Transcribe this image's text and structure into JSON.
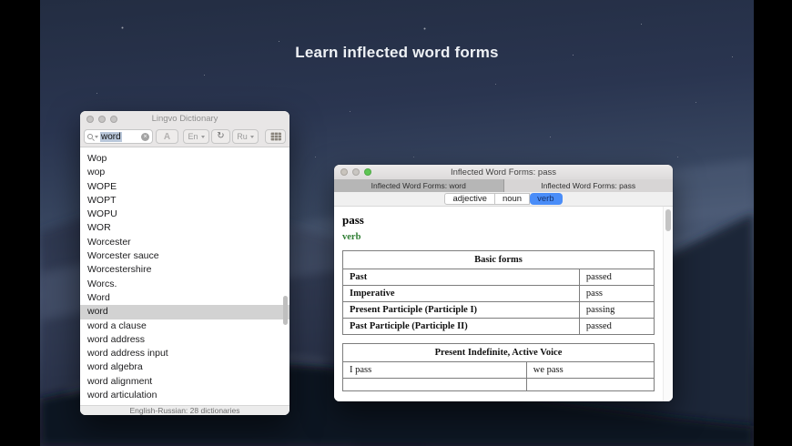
{
  "desktop": {
    "headline": "Learn inflected word forms"
  },
  "dictionary_window": {
    "title": "Lingvo Dictionary",
    "toolbar": {
      "search_value": "word",
      "font_button_label": "A",
      "source_language": "En",
      "target_language": "Ru"
    },
    "word_list": [
      "Wop",
      "wop",
      "WOPE",
      "WOPT",
      "WOPU",
      "WOR",
      "Worcester",
      "Worcester sauce",
      "Worcestershire",
      "Worcs.",
      "Word",
      "word",
      "word a clause",
      "word address",
      "word address input",
      "word algebra",
      "word alignment",
      "word articulation"
    ],
    "selected_word": "word",
    "status_bar": "English-Russian: 28 dictionaries"
  },
  "forms_window": {
    "title": "Inflected Word Forms: pass",
    "tabs": [
      {
        "label": "Inflected Word Forms: word",
        "active": false
      },
      {
        "label": "Inflected Word Forms: pass",
        "active": true
      }
    ],
    "pos_segments": [
      {
        "label": "adjective",
        "selected": false
      },
      {
        "label": "noun",
        "selected": false
      },
      {
        "label": "verb",
        "selected": true
      }
    ],
    "headword": "pass",
    "part_of_speech": "verb",
    "tables": [
      {
        "title": "Basic forms",
        "rows": [
          [
            "Past",
            "passed"
          ],
          [
            "Imperative",
            "pass"
          ],
          [
            "Present Participle (Participle I)",
            "passing"
          ],
          [
            "Past Participle (Participle II)",
            "passed"
          ]
        ]
      },
      {
        "title": "Present Indefinite, Active Voice",
        "rows": [
          [
            "I pass",
            "we pass"
          ]
        ]
      }
    ]
  },
  "icons": {
    "search": "magnifier",
    "clear": "circle-x",
    "swap": "circular-arrows",
    "dictionaries": "grid",
    "language_dropdown": "chevron-down"
  },
  "colors": {
    "segment_selected": "#4a8df8",
    "part_of_speech_green": "#2e7d32",
    "active_traffic_light_green": "#5ec654"
  }
}
